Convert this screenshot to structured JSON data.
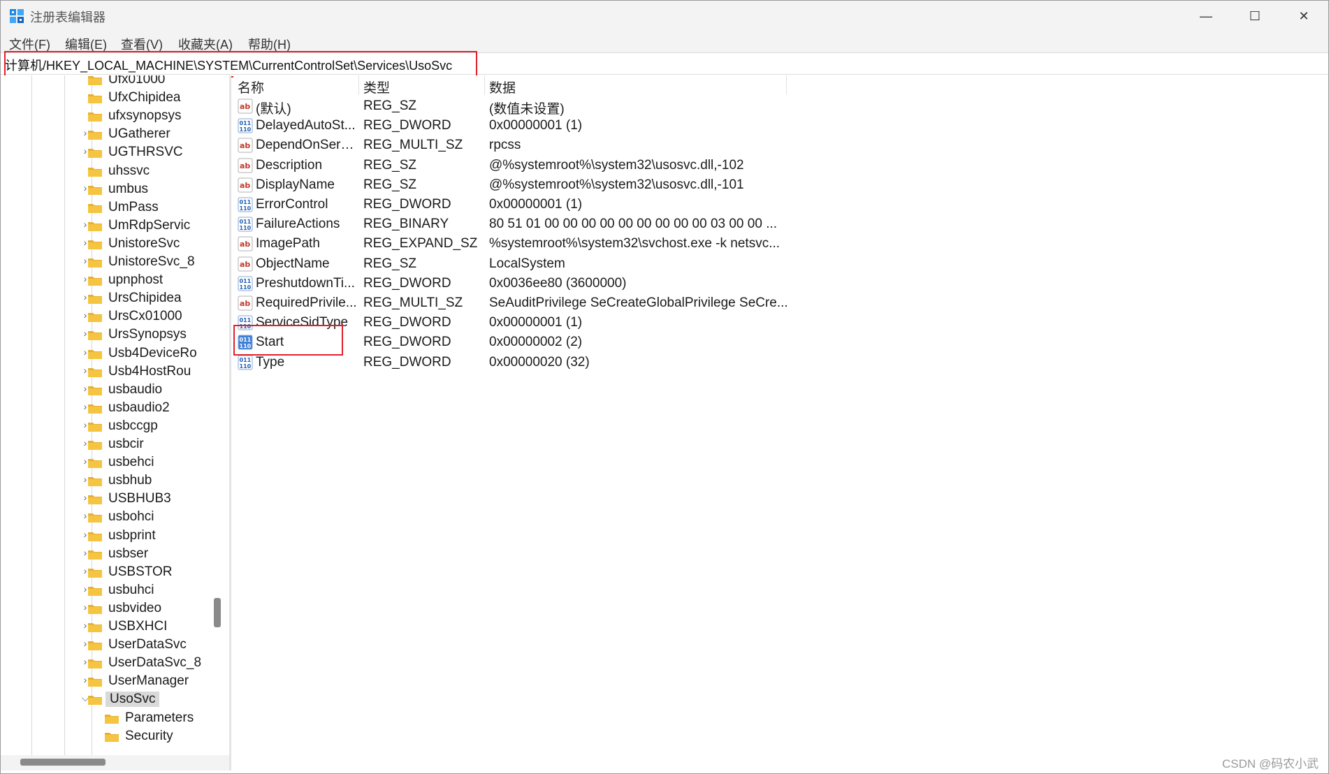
{
  "window": {
    "title": "注册表编辑器",
    "minimize_glyph": "—",
    "maximize_glyph": "☐",
    "close_glyph": "✕"
  },
  "menu": [
    "文件(F)",
    "编辑(E)",
    "查看(V)",
    "收藏夹(A)",
    "帮助(H)"
  ],
  "address": "计算机/HKEY_LOCAL_MACHINE\\SYSTEM\\CurrentControlSet\\Services\\UsoSvc",
  "tree": [
    {
      "label": "Ufx01000",
      "expandable": false
    },
    {
      "label": "UfxChipidea",
      "expandable": false
    },
    {
      "label": "ufxsynopsys",
      "expandable": false
    },
    {
      "label": "UGatherer",
      "expandable": true
    },
    {
      "label": "UGTHRSVC",
      "expandable": true
    },
    {
      "label": "uhssvc",
      "expandable": false
    },
    {
      "label": "umbus",
      "expandable": true
    },
    {
      "label": "UmPass",
      "expandable": false
    },
    {
      "label": "UmRdpServic",
      "expandable": true
    },
    {
      "label": "UnistoreSvc",
      "expandable": true
    },
    {
      "label": "UnistoreSvc_8",
      "expandable": true
    },
    {
      "label": "upnphost",
      "expandable": true
    },
    {
      "label": "UrsChipidea",
      "expandable": true
    },
    {
      "label": "UrsCx01000",
      "expandable": true
    },
    {
      "label": "UrsSynopsys",
      "expandable": true
    },
    {
      "label": "Usb4DeviceRo",
      "expandable": true
    },
    {
      "label": "Usb4HostRou",
      "expandable": true
    },
    {
      "label": "usbaudio",
      "expandable": true
    },
    {
      "label": "usbaudio2",
      "expandable": true
    },
    {
      "label": "usbccgp",
      "expandable": true
    },
    {
      "label": "usbcir",
      "expandable": true
    },
    {
      "label": "usbehci",
      "expandable": true
    },
    {
      "label": "usbhub",
      "expandable": true
    },
    {
      "label": "USBHUB3",
      "expandable": true
    },
    {
      "label": "usbohci",
      "expandable": true
    },
    {
      "label": "usbprint",
      "expandable": true
    },
    {
      "label": "usbser",
      "expandable": true
    },
    {
      "label": "USBSTOR",
      "expandable": true
    },
    {
      "label": "usbuhci",
      "expandable": true
    },
    {
      "label": "usbvideo",
      "expandable": true
    },
    {
      "label": "USBXHCI",
      "expandable": true
    },
    {
      "label": "UserDataSvc",
      "expandable": true
    },
    {
      "label": "UserDataSvc_8",
      "expandable": true
    },
    {
      "label": "UserManager",
      "expandable": true
    },
    {
      "label": "UsoSvc",
      "expandable": true,
      "expanded": true,
      "selected": true
    },
    {
      "label": "Parameters",
      "expandable": false,
      "child": true
    },
    {
      "label": "Security",
      "expandable": false,
      "child": true
    }
  ],
  "columns": {
    "name": "名称",
    "type": "类型",
    "data": "数据"
  },
  "values": [
    {
      "icon": "string",
      "name": "(默认)",
      "type": "REG_SZ",
      "data": "(数值未设置)"
    },
    {
      "icon": "binary",
      "name": "DelayedAutoSt...",
      "type": "REG_DWORD",
      "data": "0x00000001 (1)"
    },
    {
      "icon": "string",
      "name": "DependOnServi...",
      "type": "REG_MULTI_SZ",
      "data": "rpcss"
    },
    {
      "icon": "string",
      "name": "Description",
      "type": "REG_SZ",
      "data": "@%systemroot%\\system32\\usosvc.dll,-102"
    },
    {
      "icon": "string",
      "name": "DisplayName",
      "type": "REG_SZ",
      "data": "@%systemroot%\\system32\\usosvc.dll,-101"
    },
    {
      "icon": "binary",
      "name": "ErrorControl",
      "type": "REG_DWORD",
      "data": "0x00000001 (1)"
    },
    {
      "icon": "binary",
      "name": "FailureActions",
      "type": "REG_BINARY",
      "data": "80 51 01 00 00 00 00 00 00 00 00 00 03 00 00 ..."
    },
    {
      "icon": "string",
      "name": "ImagePath",
      "type": "REG_EXPAND_SZ",
      "data": "%systemroot%\\system32\\svchost.exe -k netsvc..."
    },
    {
      "icon": "string",
      "name": "ObjectName",
      "type": "REG_SZ",
      "data": "LocalSystem"
    },
    {
      "icon": "binary",
      "name": "PreshutdownTi...",
      "type": "REG_DWORD",
      "data": "0x0036ee80 (3600000)"
    },
    {
      "icon": "string",
      "name": "RequiredPrivile...",
      "type": "REG_MULTI_SZ",
      "data": "SeAuditPrivilege SeCreateGlobalPrivilege SeCre..."
    },
    {
      "icon": "binary",
      "name": "ServiceSidType",
      "type": "REG_DWORD",
      "data": "0x00000001 (1)"
    },
    {
      "icon": "binary",
      "name": "Start",
      "type": "REG_DWORD",
      "data": "0x00000002 (2)",
      "highlighted": true
    },
    {
      "icon": "binary",
      "name": "Type",
      "type": "REG_DWORD",
      "data": "0x00000020 (32)"
    }
  ],
  "watermark": "CSDN @码农小武",
  "colors": {
    "highlight": "#e0202a",
    "folder": "#f5c542",
    "selection": "#d9d9d9"
  }
}
